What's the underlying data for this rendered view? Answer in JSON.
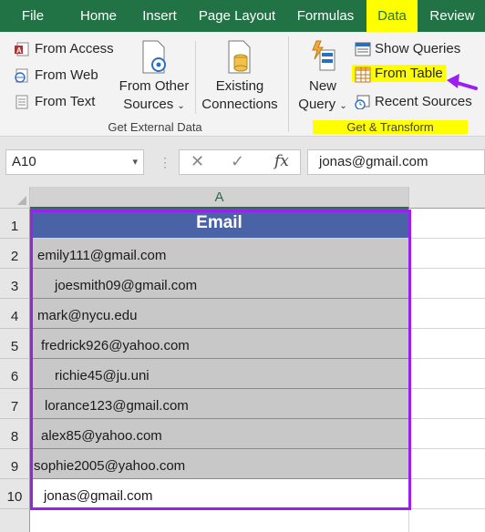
{
  "ribbon_tabs": [
    {
      "label": "File",
      "active": false
    },
    {
      "label": "Home",
      "active": false
    },
    {
      "label": "Insert",
      "active": false
    },
    {
      "label": "Page Layout",
      "active": false
    },
    {
      "label": "Formulas",
      "active": false
    },
    {
      "label": "Data",
      "active": true
    },
    {
      "label": "Review",
      "active": false
    }
  ],
  "external_data": {
    "from_access": "From Access",
    "from_web": "From Web",
    "from_text": "From Text",
    "from_other_line1": "From Other",
    "from_other_line2": "Sources",
    "existing_line1": "Existing",
    "existing_line2": "Connections",
    "group_label": "Get External Data"
  },
  "transform": {
    "new_query_line1": "New",
    "new_query_line2": "Query",
    "show_queries": "Show Queries",
    "from_table": "From Table",
    "recent_sources": "Recent Sources",
    "group_label": "Get & Transform"
  },
  "formula_bar": {
    "name_box": "A10",
    "fx_label": "fx",
    "formula": "jonas@gmail.com"
  },
  "grid": {
    "column_headers": [
      "A"
    ],
    "row_numbers": [
      "1",
      "2",
      "3",
      "4",
      "5",
      "6",
      "7",
      "8",
      "9",
      "10"
    ],
    "header_cell": "Email",
    "emails": [
      "emily111@gmail.com",
      "joesmith09@gmail.com",
      "mark@nycu.edu",
      "fredrick926@yahoo.com",
      "richie45@ju.uni",
      "lorance123@gmail.com",
      "alex85@yahoo.com",
      "sophie2005@yahoo.com",
      "jonas@gmail.com"
    ]
  },
  "colors": {
    "ribbon_green": "#217346",
    "highlight_yellow": "#ffff00",
    "table_header_blue": "#4a63a7",
    "selection_purple": "#9b1ff0",
    "arrow_purple": "#9b1ff0"
  },
  "icons": [
    "access-icon",
    "web-icon",
    "text-file-icon",
    "other-sources-icon",
    "connections-icon",
    "new-query-icon",
    "show-queries-icon",
    "from-table-icon",
    "recent-sources-icon",
    "arrow-pointer-icon"
  ]
}
